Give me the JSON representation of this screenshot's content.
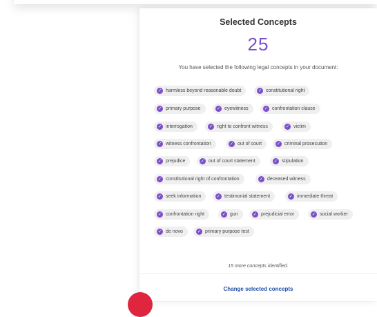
{
  "panel": {
    "title": "Selected Concepts",
    "count": "25",
    "description": "You have selected the following legal concepts in your document:",
    "more_text": "15 more concepts identified.",
    "change_link": "Change selected concepts"
  },
  "concepts": [
    "harmless beyond reasonable doubt",
    "constitutional right",
    "primary purpose",
    "eyewitness",
    "confrontation clause",
    "interrogation",
    "right to confront witness",
    "victim",
    "witness confrontation",
    "out of court",
    "criminal prosecution",
    "prejudice",
    "out of court statement",
    "stipulation",
    "constitutional right of confrontation",
    "deceased witness",
    "seek information",
    "testimonial statement",
    "immediate threat",
    "confrontation right",
    "gun",
    "prejudicial error",
    "social worker",
    "de novo",
    "primary purpose test"
  ],
  "colors": {
    "accent": "#7b4fc9",
    "link": "#1f4fa8",
    "badge": "#e0263f"
  },
  "icons": {
    "chip_icon": "check-circle-icon"
  }
}
